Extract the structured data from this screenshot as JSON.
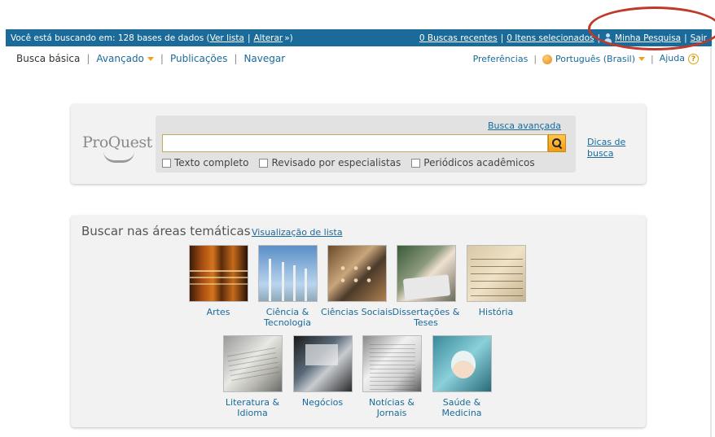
{
  "topbar": {
    "searching_text": "Você está buscando em: 128 bases de dados (",
    "view_list": "Ver lista",
    "pipe": "|",
    "change": "Alterar",
    "change_suffix": "»)",
    "recent_searches": "0 Buscas recentes",
    "selected_items": "0 Itens selecionados",
    "my_research": "Minha Pesquisa",
    "logout": "Sair"
  },
  "nav": {
    "basic": "Busca básica",
    "advanced": "Avançado",
    "publications": "Publicações",
    "browse": "Navegar",
    "preferences": "Preferências",
    "language": "Português (Brasil)",
    "help": "Ajuda",
    "help_glyph": "?"
  },
  "search": {
    "logo": "ProQuest",
    "advanced_link": "Busca avançada",
    "query": "",
    "tips": "Dicas de busca",
    "filters": [
      {
        "label": "Texto completo",
        "checked": false
      },
      {
        "label": "Revisado por especialistas",
        "checked": false
      },
      {
        "label": "Periódicos acadêmicos",
        "checked": false
      }
    ]
  },
  "areas": {
    "title": "Buscar nas áreas temáticas",
    "list_view": "Visualização de lista",
    "subjects": [
      {
        "label": "Artes",
        "icon": "violins-image"
      },
      {
        "label": "Ciência & Tecnologia",
        "icon": "wind-turbines-image"
      },
      {
        "label": "Ciências Sociais",
        "icon": "crowd-image"
      },
      {
        "label": "Dissertações & Teses",
        "icon": "student-laptop-image"
      },
      {
        "label": "História",
        "icon": "old-manuscript-image"
      },
      {
        "label": "Literatura & Idioma",
        "icon": "open-book-image"
      },
      {
        "label": "Negócios",
        "icon": "meeting-image"
      },
      {
        "label": "Notícias & Jornais",
        "icon": "newspaper-image"
      },
      {
        "label": "Saúde & Medicina",
        "icon": "surgeon-image"
      }
    ]
  },
  "colors": {
    "topbar": "#1a6a9a",
    "link": "#1a6a9a",
    "highlight": "#c0392b",
    "search_button": "#f39c12"
  }
}
